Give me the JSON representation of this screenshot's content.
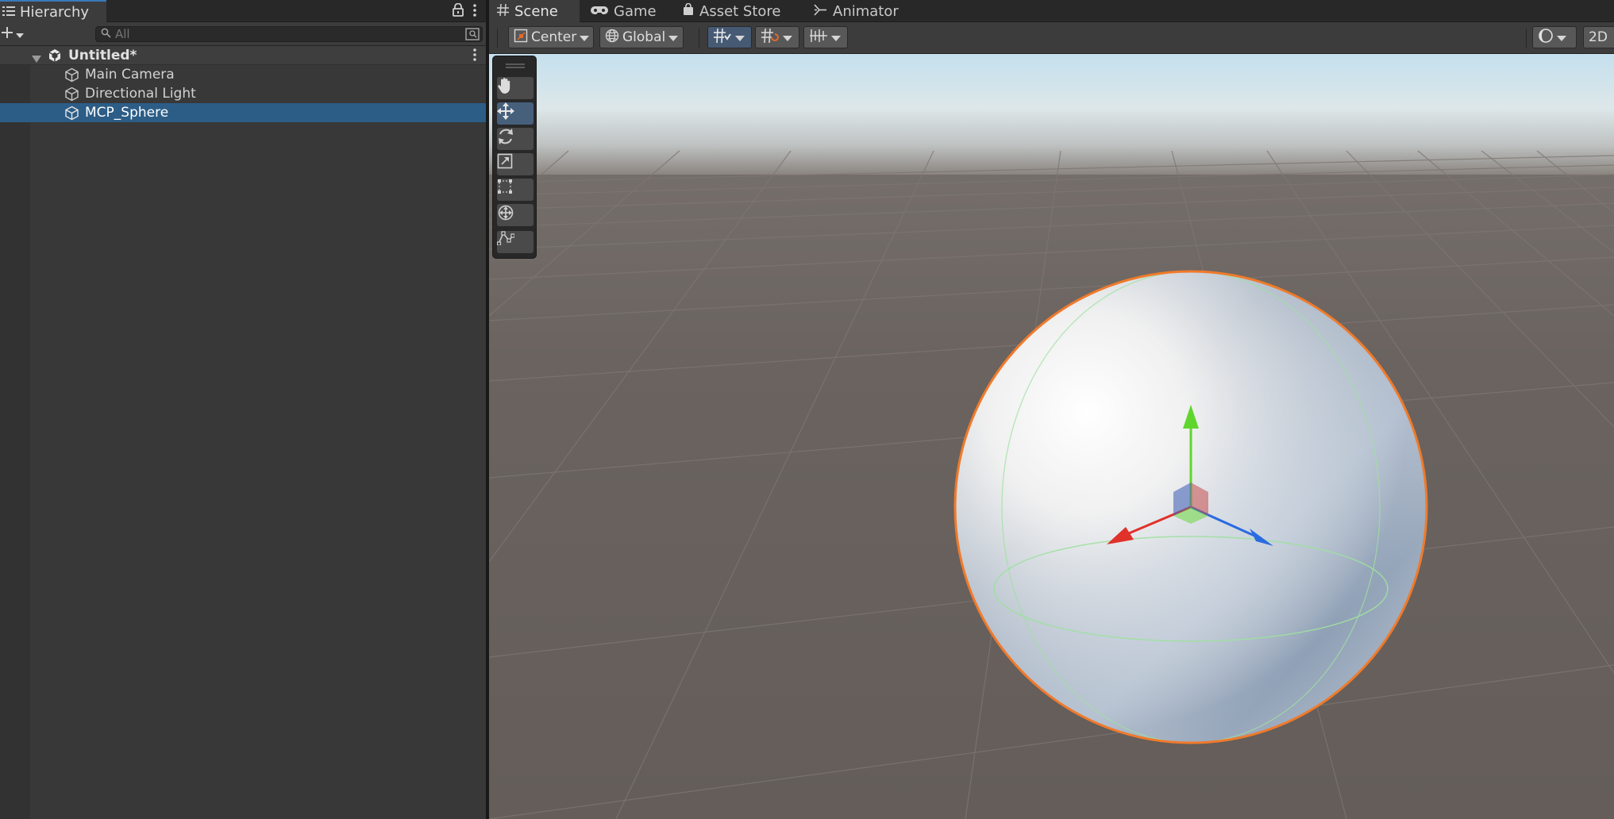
{
  "hierarchy": {
    "tab_title": "Hierarchy",
    "search": {
      "placeholder": "All",
      "value": ""
    },
    "scene": {
      "name": "Untitled*"
    },
    "items": [
      {
        "label": "Main Camera",
        "icon": "cube-icon",
        "selected": false
      },
      {
        "label": "Directional Light",
        "icon": "cube-icon",
        "selected": false
      },
      {
        "label": "MCP_Sphere",
        "icon": "cube-icon",
        "selected": true
      }
    ]
  },
  "scene_view": {
    "tabs": [
      {
        "label": "Scene",
        "icon": "grid-hash-icon",
        "active": true
      },
      {
        "label": "Game",
        "icon": "gamepad-icon",
        "active": false
      },
      {
        "label": "Asset Store",
        "icon": "shopping-bag-icon",
        "active": false
      },
      {
        "label": "Animator",
        "icon": "animator-icon",
        "active": false
      }
    ],
    "toolbar": {
      "pivot_mode": "Center",
      "pivot_rotation": "Global",
      "mode_2d": "2D"
    },
    "tools": [
      "hand-tool",
      "move-tool",
      "rotate-tool",
      "scale-tool",
      "rect-tool",
      "transform-tool",
      "custom-tool"
    ],
    "active_tool": "move-tool",
    "selected_object": "MCP_Sphere"
  },
  "colors": {
    "selection": "#2c5d87",
    "selection_outline": "#f07a2a",
    "axis_x": "#e0312a",
    "axis_y": "#5fd62e",
    "axis_z": "#2a6be0",
    "accent": "#3a79bb"
  }
}
